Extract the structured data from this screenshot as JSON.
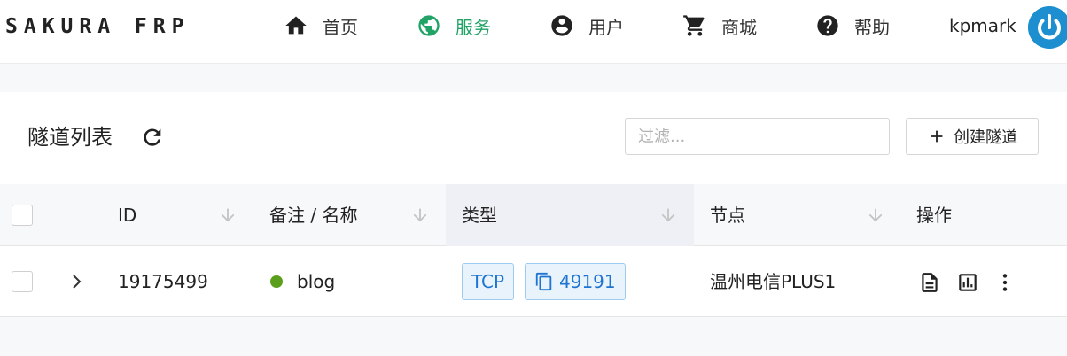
{
  "header": {
    "brand": "SAKURA FRP",
    "nav": [
      {
        "label": "首页",
        "icon": "home-icon"
      },
      {
        "label": "服务",
        "icon": "globe-icon"
      },
      {
        "label": "用户",
        "icon": "account-icon"
      },
      {
        "label": "商城",
        "icon": "cart-icon"
      },
      {
        "label": "帮助",
        "icon": "help-icon"
      }
    ],
    "active_nav": "服务",
    "username": "kpmark"
  },
  "tunnels": {
    "title": "隧道列表",
    "filter_placeholder": "过滤...",
    "create_label": "创建隧道",
    "columns": [
      "ID",
      "备注 / 名称",
      "类型",
      "节点",
      "操作"
    ],
    "rows": [
      {
        "id": "19175499",
        "name": "blog",
        "status": "online",
        "type": "TCP",
        "port": "49191",
        "node": "温州电信PLUS1"
      }
    ]
  },
  "colors": {
    "accent": "#21a366",
    "tag_text": "#1f74d0",
    "tag_bg": "#e8f3fc",
    "status_online": "#5a9e1b",
    "avatar_bg": "#1d8fd0"
  }
}
